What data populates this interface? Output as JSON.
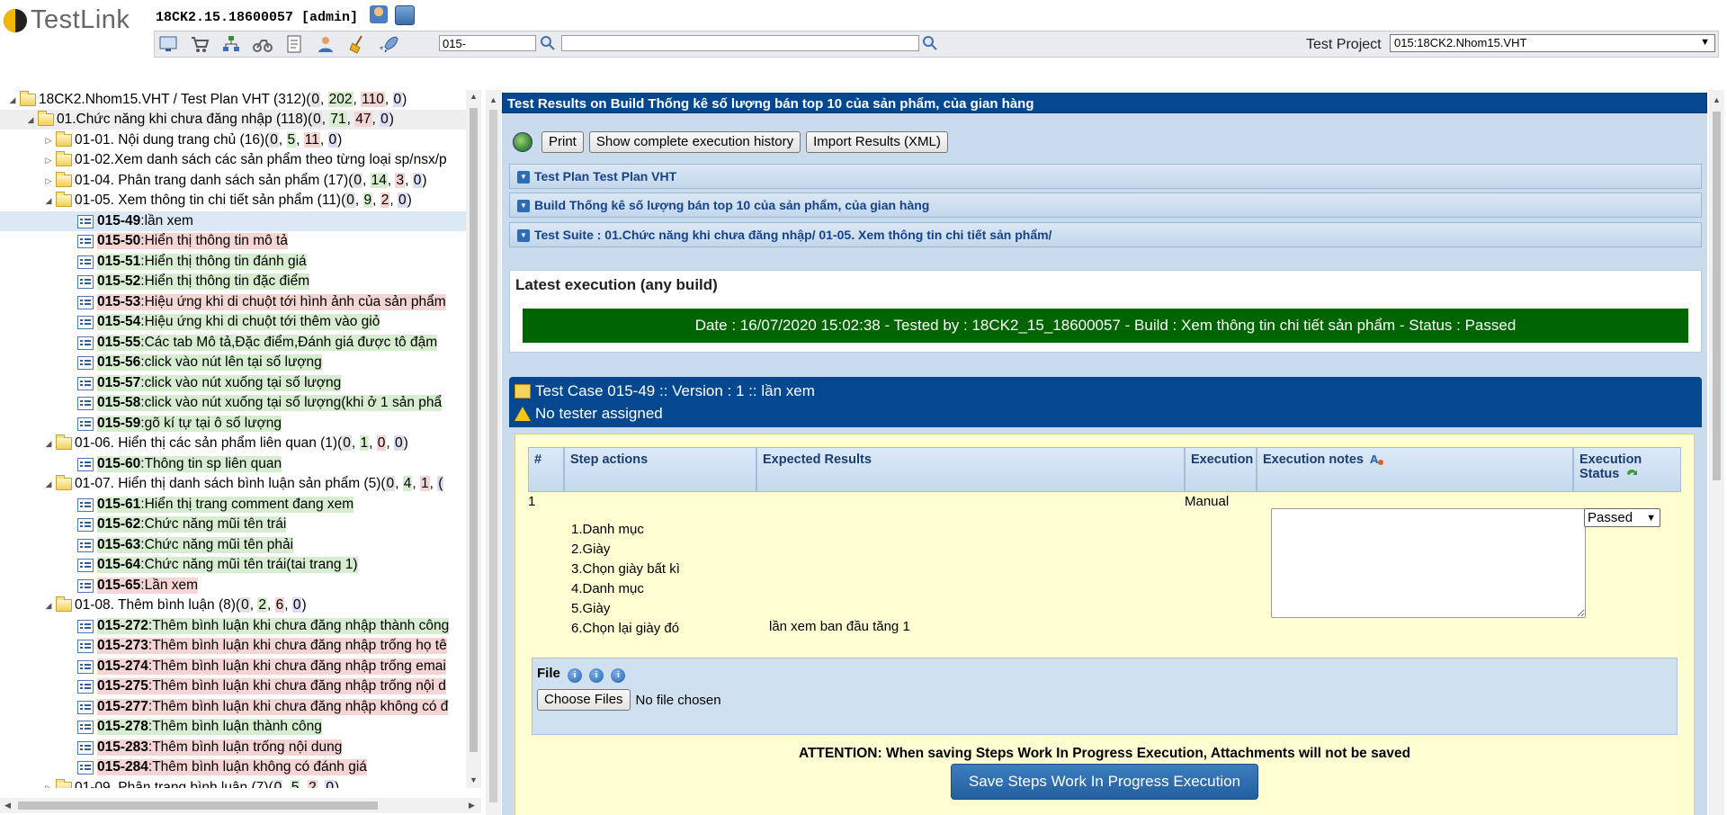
{
  "app": {
    "logo": "TestLink",
    "user_info": "18CK2.15.18600057 [admin]"
  },
  "toolbar": {
    "icons": [
      "desktop-icon",
      "cart-icon",
      "hierarchy-icon",
      "bike-icon",
      "document-icon",
      "user-icon",
      "broom-icon",
      "rocket-icon"
    ],
    "search_value": "015-",
    "search2_value": "",
    "test_project_label": "Test Project",
    "test_project_value": "015:18CK2.Nhom15.VHT"
  },
  "tree": {
    "root": {
      "label": "18CK2.Nhom15.VHT / Test Plan VHT (312)",
      "counts": [
        "0",
        "202",
        "110",
        "0"
      ]
    },
    "nodes": [
      {
        "type": "folder",
        "indent": 1,
        "toggle": "open",
        "label": "01.Chức năng khi chưa đăng nhập (118)",
        "counts": [
          "0",
          "71",
          "47",
          "0"
        ],
        "hl": true
      },
      {
        "type": "folder",
        "indent": 2,
        "toggle": "closed",
        "label": "01-01. Nội dung trang chủ (16)",
        "counts": [
          "0",
          "5",
          "11",
          "0"
        ]
      },
      {
        "type": "folder",
        "indent": 2,
        "toggle": "closed",
        "label": "01-02.Xem danh sách các sản phẩm theo từng loại sp/nsx/p",
        "counts": []
      },
      {
        "type": "folder",
        "indent": 2,
        "toggle": "closed",
        "label": "01-04. Phân trang danh sách sản phẩm (17)",
        "counts": [
          "0",
          "14",
          "3",
          "0"
        ]
      },
      {
        "type": "folder",
        "indent": 2,
        "toggle": "open",
        "label": "01-05. Xem thông tin chi tiết sản phẩm (11)",
        "counts": [
          "0",
          "9",
          "2",
          "0"
        ]
      },
      {
        "type": "tc",
        "indent": 3,
        "id": "015-49",
        "title": "lần xem",
        "status": "pass",
        "sel": true
      },
      {
        "type": "tc",
        "indent": 3,
        "id": "015-50",
        "title": "Hiển thị thông tin mô tả",
        "status": "fail"
      },
      {
        "type": "tc",
        "indent": 3,
        "id": "015-51",
        "title": "Hiển thị thông tin đánh giá",
        "status": "pass"
      },
      {
        "type": "tc",
        "indent": 3,
        "id": "015-52",
        "title": "Hiển thị thông tin đặc điểm",
        "status": "pass"
      },
      {
        "type": "tc",
        "indent": 3,
        "id": "015-53",
        "title": "Hiệu ứng khi di chuột tới hình ảnh của sản phẩm",
        "status": "fail"
      },
      {
        "type": "tc",
        "indent": 3,
        "id": "015-54",
        "title": "Hiệu ứng khi di chuột tới thêm vào giỏ",
        "status": "pass"
      },
      {
        "type": "tc",
        "indent": 3,
        "id": "015-55",
        "title": "Các tab Mô tả,Đặc điểm,Đánh giá được tô đậm",
        "status": "pass"
      },
      {
        "type": "tc",
        "indent": 3,
        "id": "015-56",
        "title": "click vào nút lên tại số lượng",
        "status": "pass"
      },
      {
        "type": "tc",
        "indent": 3,
        "id": "015-57",
        "title": "click vào nút xuống tại số lượng",
        "status": "pass"
      },
      {
        "type": "tc",
        "indent": 3,
        "id": "015-58",
        "title": "click vào nút xuống tại số lượng(khi ở 1 sản phẩ",
        "status": "pass"
      },
      {
        "type": "tc",
        "indent": 3,
        "id": "015-59",
        "title": "gõ kí tự tại ô số lượng",
        "status": "pass"
      },
      {
        "type": "folder",
        "indent": 2,
        "toggle": "open",
        "label": "01-06. Hiển thị các sản phẩm liên quan (1)",
        "counts": [
          "0",
          "1",
          "0",
          "0"
        ]
      },
      {
        "type": "tc",
        "indent": 3,
        "id": "015-60",
        "title": "Thông tin sp liên quan",
        "status": "pass"
      },
      {
        "type": "folder",
        "indent": 2,
        "toggle": "open",
        "label": "01-07. Hiển thị danh sách bình luận sản phẩm (5)",
        "counts": [
          "0",
          "4",
          "1",
          "("
        ]
      },
      {
        "type": "tc",
        "indent": 3,
        "id": "015-61",
        "title": "Hiển thị trang comment đang xem",
        "status": "pass"
      },
      {
        "type": "tc",
        "indent": 3,
        "id": "015-62",
        "title": "Chức năng mũi tên trái",
        "status": "pass"
      },
      {
        "type": "tc",
        "indent": 3,
        "id": "015-63",
        "title": "Chức năng mũi tên phải",
        "status": "pass"
      },
      {
        "type": "tc",
        "indent": 3,
        "id": "015-64",
        "title": "Chức năng mũi tên trái(tai trang 1)",
        "status": "pass"
      },
      {
        "type": "tc",
        "indent": 3,
        "id": "015-65",
        "title": "Lần xem",
        "status": "fail"
      },
      {
        "type": "folder",
        "indent": 2,
        "toggle": "open",
        "label": "01-08. Thêm bình luận (8)",
        "counts": [
          "0",
          "2",
          "6",
          "0"
        ]
      },
      {
        "type": "tc",
        "indent": 3,
        "id": "015-272",
        "title": "Thêm bình luận khi chưa đăng nhập thành công",
        "status": "pass"
      },
      {
        "type": "tc",
        "indent": 3,
        "id": "015-273",
        "title": "Thêm bình luận khi chưa đăng nhập trống họ tê",
        "status": "fail"
      },
      {
        "type": "tc",
        "indent": 3,
        "id": "015-274",
        "title": "Thêm bình luận khi chưa đăng nhập trống emai",
        "status": "fail"
      },
      {
        "type": "tc",
        "indent": 3,
        "id": "015-275",
        "title": "Thêm bình luận khi chưa đăng nhập trống nội d",
        "status": "fail"
      },
      {
        "type": "tc",
        "indent": 3,
        "id": "015-277",
        "title": "Thêm bình luận khi chưa đăng nhập không có đ",
        "status": "fail"
      },
      {
        "type": "tc",
        "indent": 3,
        "id": "015-278",
        "title": "Thêm bình luận thành công",
        "status": "pass"
      },
      {
        "type": "tc",
        "indent": 3,
        "id": "015-283",
        "title": "Thêm bình luận trống nội dung",
        "status": "fail"
      },
      {
        "type": "tc",
        "indent": 3,
        "id": "015-284",
        "title": "Thêm bình luận không có đánh giá",
        "status": "fail"
      },
      {
        "type": "folder",
        "indent": 2,
        "toggle": "closed",
        "label": "01-09. Phân trang bình luận (7)",
        "counts": [
          "0",
          "5",
          "2",
          "0"
        ]
      }
    ]
  },
  "results": {
    "title": "Test Results on Build Thống kê số lượng bán top 10 của sản phẩm, của gian hàng",
    "buttons": {
      "print": "Print",
      "history": "Show complete execution history",
      "import": "Import Results (XML)"
    },
    "sections": [
      "Test Plan Test Plan VHT",
      "Build Thống kê số lượng bán top 10 của sản phẩm, của gian hàng",
      "Test Suite : 01.Chức năng khi chưa đăng nhập/ 01-05. Xem thông tin chi tiết sản phẩm/"
    ],
    "latest_title": "Latest execution (any build)",
    "latest_text": "Date : 16/07/2020 15:02:38 - Tested by : 18CK2_15_18600057 - Build : Xem thông tin chi tiết sản phẩm - Status : Passed",
    "tc_title": "Test Case 015-49 :: Version : 1 :: lần xem",
    "tc_tester": "No tester assigned",
    "table": {
      "headers": {
        "num": "#",
        "actions": "Step actions",
        "expected": "Expected Results",
        "execution": "Execution",
        "notes": "Execution notes",
        "status_1": "Execution",
        "status_2": "Status"
      },
      "step_num": "1",
      "execution_type": "Manual",
      "step_actions": [
        "1.Danh mục",
        "2.Giày",
        "3.Chọn giày bất kì",
        "4.Danh mục",
        "5.Giày",
        "6.Chọn lại giày đó"
      ],
      "expected": "lần xem ban đầu tăng 1",
      "status_value": "Passed"
    },
    "file_label": "File",
    "choose_files": "Choose Files",
    "no_file": "No file chosen",
    "attention": "ATTENTION: When saving Steps Work In Progress Execution, Attachments will not be saved",
    "save_button": "Save Steps Work In Progress Execution"
  }
}
